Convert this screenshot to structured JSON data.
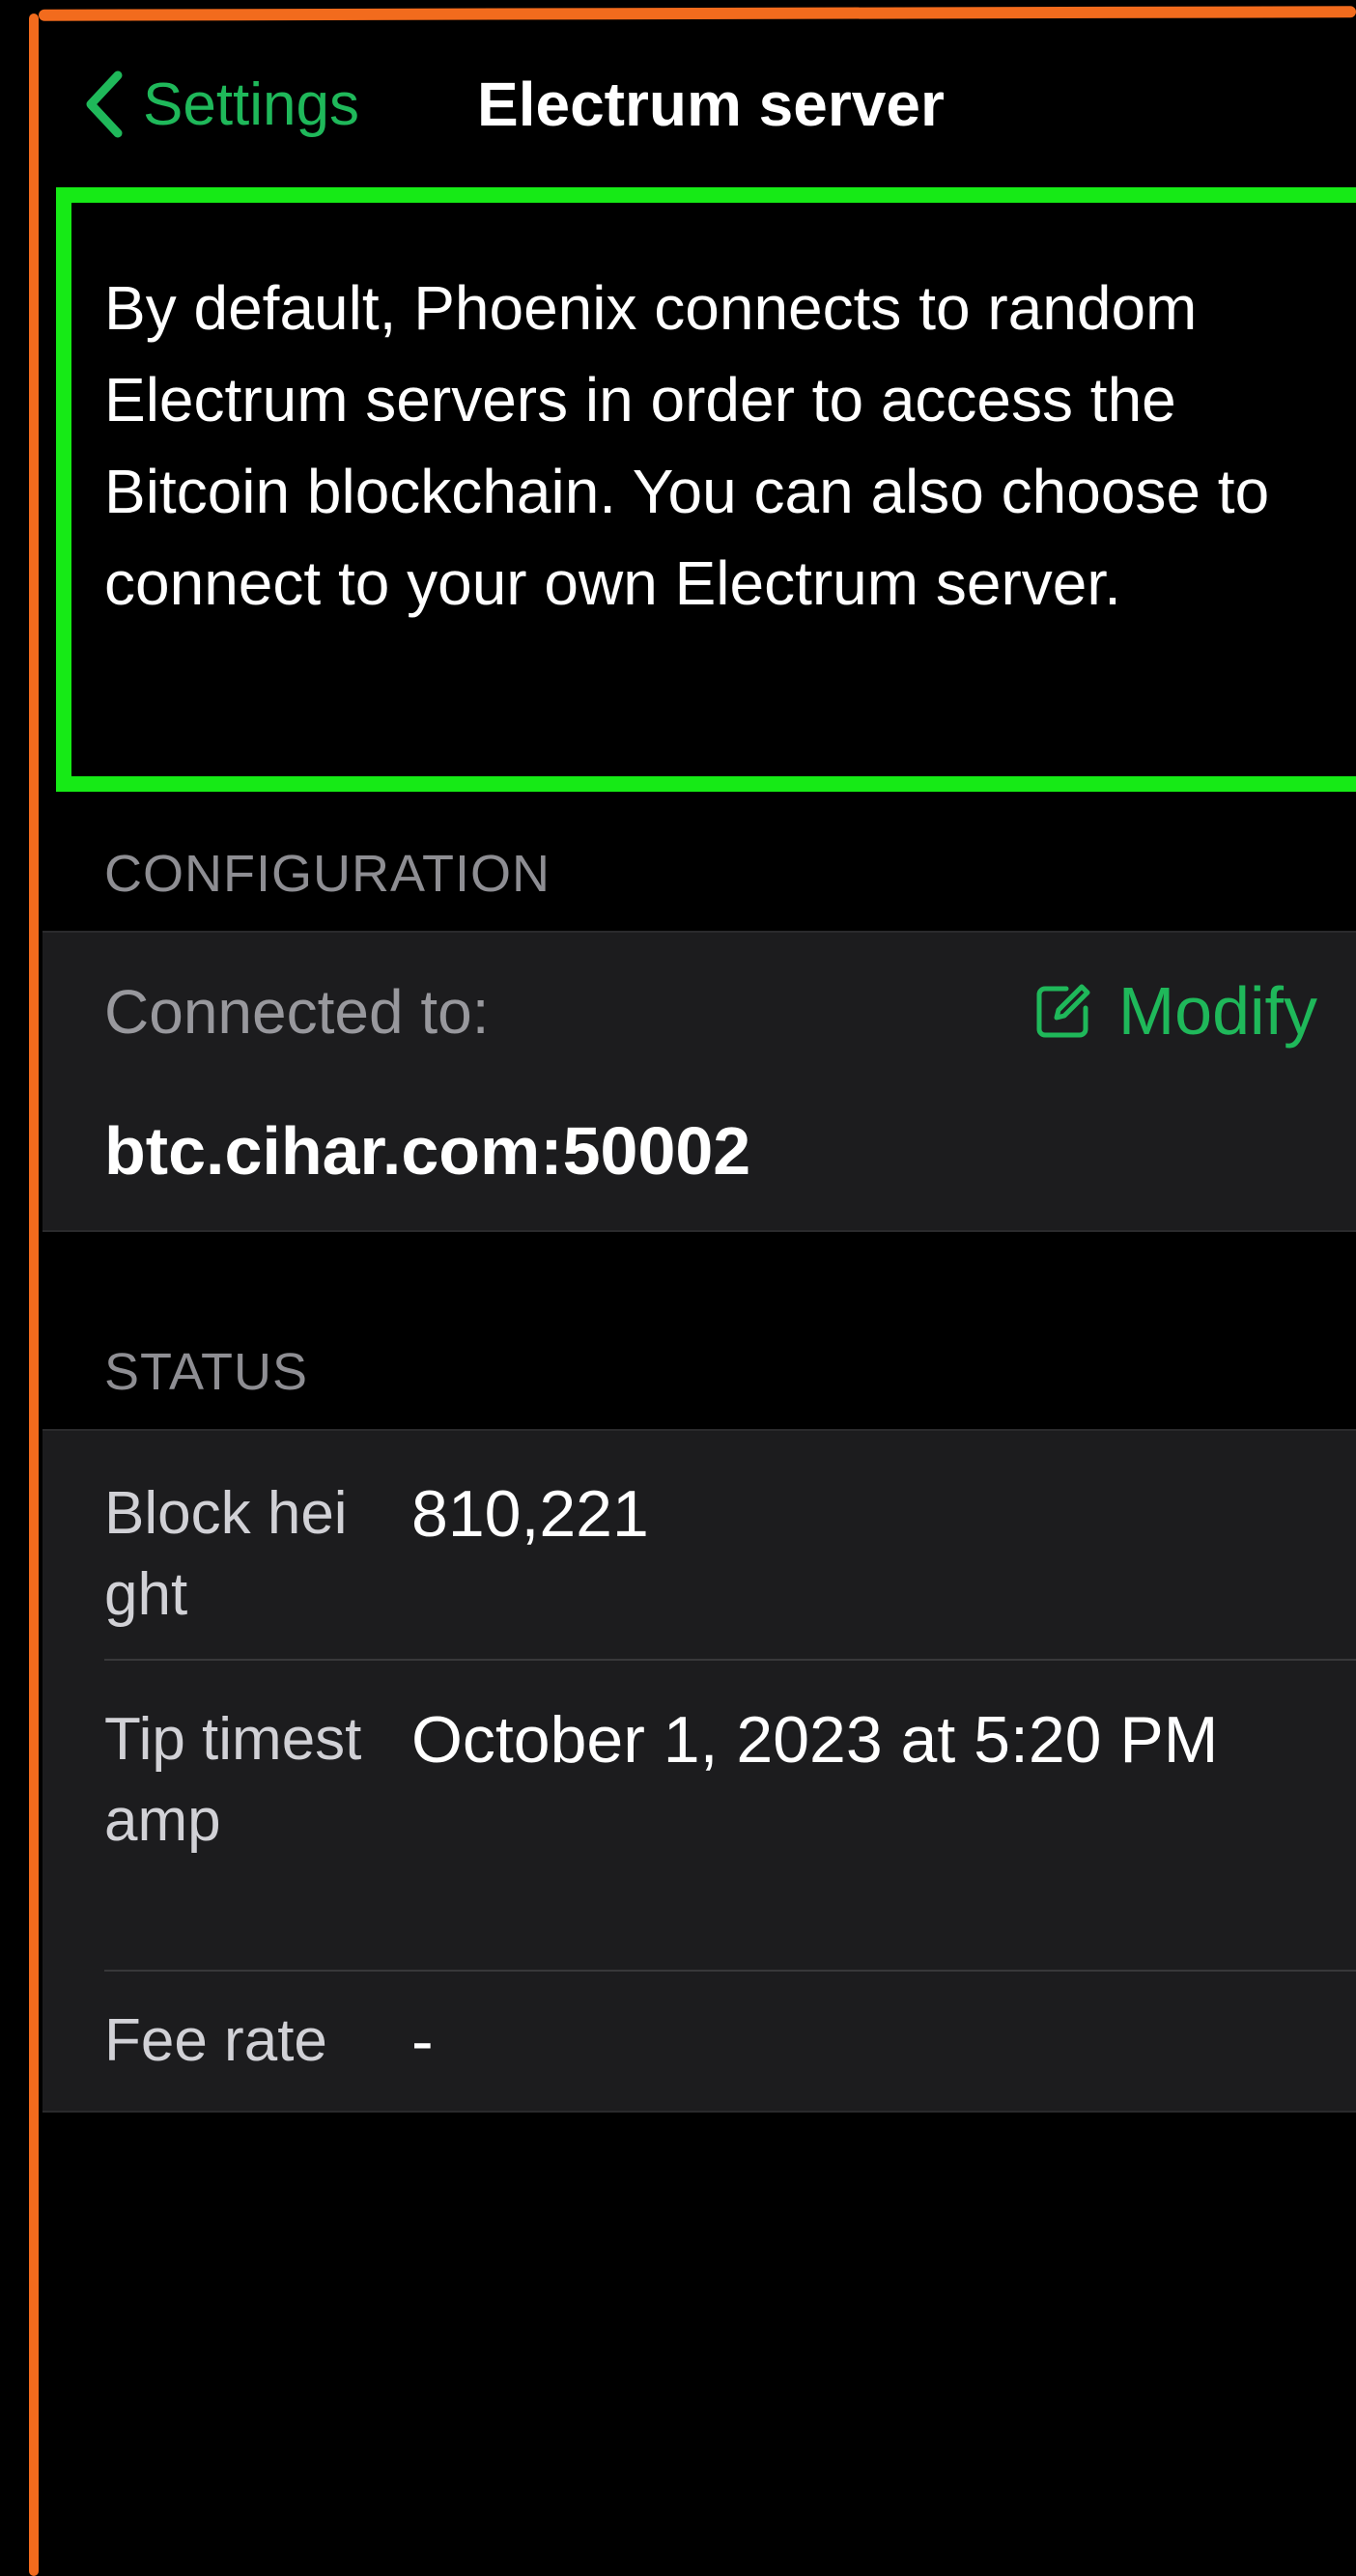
{
  "nav": {
    "back_label": "Settings",
    "title": "Electrum server"
  },
  "description": "By default, Phoenix connects to random Electrum servers in order to access the Bitcoin blockchain. You can also choose to connect to your own Electrum server.",
  "configuration": {
    "header": "CONFIGURATION",
    "connected_label": "Connected to:",
    "modify_label": "Modify",
    "server": "btc.cihar.com:50002"
  },
  "status": {
    "header": "STATUS",
    "rows": [
      {
        "label": "Block height",
        "value": "810,221"
      },
      {
        "label": "Tip timestamp",
        "value": "October 1, 2023 at 5:20 PM"
      },
      {
        "label": "Fee rate",
        "value": "-"
      }
    ]
  },
  "colors": {
    "accent": "#1fb85a",
    "highlight": "#16ea16",
    "frame": "#f26b1d"
  },
  "icons": {
    "back": "chevron-left-icon",
    "modify": "square-and-pencil-icon"
  }
}
